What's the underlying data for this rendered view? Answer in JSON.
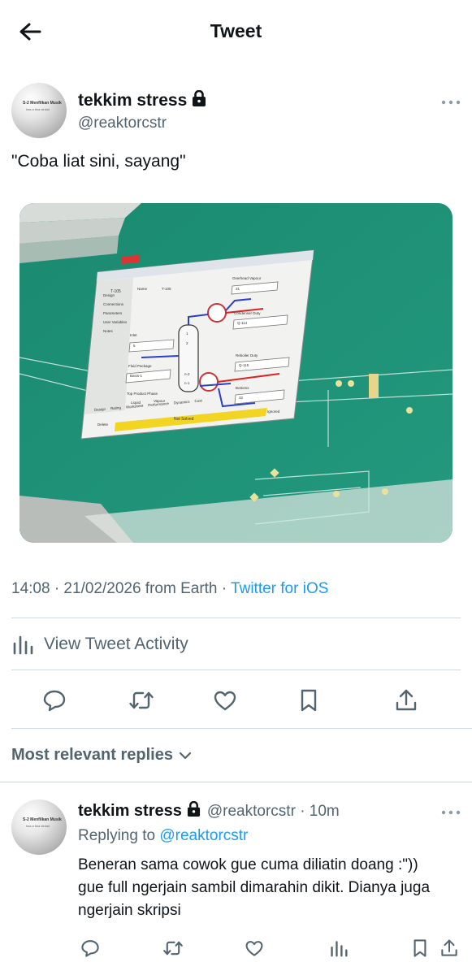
{
  "header": {
    "title": "Tweet",
    "back_icon": "arrow-left-icon"
  },
  "tweet": {
    "author_name": "tekkim stress",
    "author_handle": "@reaktorcstr",
    "avatar_text_line1": "S-2 Menfilkan Musik",
    "avatar_text_line2": "has a tina sinlad",
    "text": "\"Coba liat sini, sayang\"",
    "timestamp": "14:08 · 21/02/2026 from Earth · ",
    "source": "Twitter for iOS",
    "media": {
      "window_title": "T-105",
      "menu_items": [
        "Design",
        "Connections",
        "Parameters",
        "User Variables",
        "Notes"
      ],
      "name_label": "Name",
      "name_value": "T-105",
      "inlet_label": "Inlet",
      "inlet_value": "5",
      "fluid_package_label": "Fluid Package",
      "fluid_package_value": "Basis-1",
      "top_phase_label": "Top Product Phase",
      "liquid_label": "Liquid",
      "vapour_label": "Vapour",
      "overhead_label": "Overhead Vapour",
      "overhead_value": "31",
      "condenser_label": "Condenser Duty",
      "condenser_value": "Q-114",
      "reboiler_label": "Reboiler Duty",
      "reboiler_value": "Q-115",
      "bottoms_label": "Bottoms",
      "bottoms_value": "32",
      "tray_top": "1",
      "tray_mid": "2",
      "tray_n2": "n-2",
      "tray_n1": "n-1",
      "tabs": [
        "Design",
        "Rating",
        "Worksheet",
        "Performance",
        "Dynamics",
        "Cost"
      ],
      "delete_label": "Delete",
      "status": "Not Solved",
      "ignored_label": "Ignored"
    }
  },
  "activity": {
    "label": "View Tweet Activity",
    "icon": "analytics-icon"
  },
  "actions": [
    "reply-icon",
    "retweet-icon",
    "like-icon",
    "bookmark-icon",
    "share-icon"
  ],
  "replies": {
    "header": "Most relevant replies",
    "items": [
      {
        "author_name": "tekkim stress",
        "author_handle": "@reaktorcstr",
        "time": "· 10m",
        "replying_prefix": "Replying to ",
        "replying_to": "@reaktorcstr",
        "text": "Beneran sama cowok gue cuma diliatin doang :\")) gue full ngerjain sambil dimarahin dikit. Dianya juga ngerjain skripsi"
      }
    ]
  },
  "colors": {
    "accent": "#1d9bf0",
    "text": "#0f1419",
    "secondary": "#536471",
    "divider": "#cfd9de",
    "screen_green": "#1e8f74"
  }
}
